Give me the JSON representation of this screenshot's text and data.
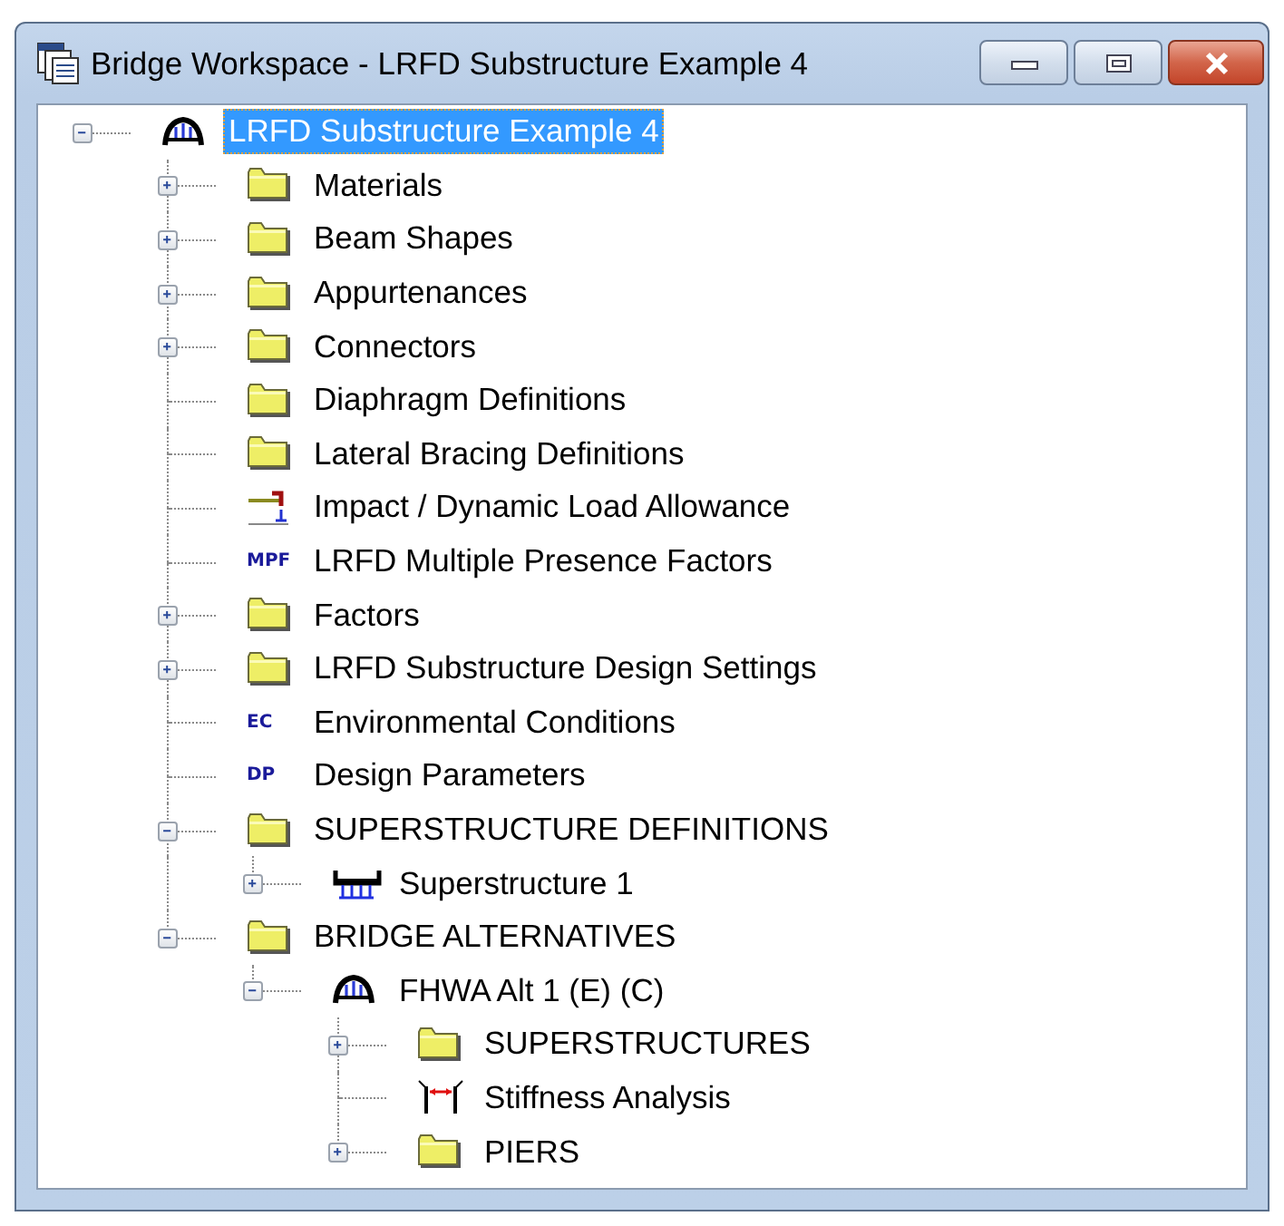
{
  "window": {
    "title": "Bridge Workspace - LRFD Substructure Example 4"
  },
  "tree": [
    {
      "label": "LRFD Substructure Example 4",
      "kind": "bridge",
      "selected": true,
      "expanded": true,
      "children": [
        {
          "label": "Materials",
          "kind": "folder",
          "selected": false,
          "expanded": false
        },
        {
          "label": "Beam Shapes",
          "kind": "folder",
          "selected": false,
          "expanded": false
        },
        {
          "label": "Appurtenances",
          "kind": "folder",
          "selected": false,
          "expanded": false
        },
        {
          "label": "Connectors",
          "kind": "folder",
          "selected": false,
          "expanded": false
        },
        {
          "label": "Diaphragm Definitions",
          "kind": "folder",
          "selected": false
        },
        {
          "label": "Lateral Bracing Definitions",
          "kind": "folder",
          "selected": false
        },
        {
          "label": "Impact / Dynamic Load Allowance",
          "kind": "impact",
          "selected": false
        },
        {
          "label": "LRFD Multiple Presence Factors",
          "kind": "badge",
          "icon_text": "MPF",
          "selected": false
        },
        {
          "label": "Factors",
          "kind": "folder",
          "selected": false,
          "expanded": false
        },
        {
          "label": "LRFD Substructure Design Settings",
          "kind": "folder",
          "selected": false,
          "expanded": false
        },
        {
          "label": "Environmental Conditions",
          "kind": "badge",
          "icon_text": "EC",
          "selected": false
        },
        {
          "label": "Design Parameters",
          "kind": "badge",
          "icon_text": "DP",
          "selected": false
        },
        {
          "label": "SUPERSTRUCTURE DEFINITIONS",
          "kind": "folder",
          "selected": false,
          "expanded": true,
          "children": [
            {
              "label": "Superstructure 1",
              "kind": "superstructure",
              "selected": false,
              "expanded": false
            }
          ]
        },
        {
          "label": "BRIDGE ALTERNATIVES",
          "kind": "folder",
          "selected": false,
          "expanded": true,
          "children": [
            {
              "label": "FHWA Alt 1 (E) (C)",
              "kind": "bridge",
              "selected": false,
              "expanded": true,
              "children": [
                {
                  "label": "SUPERSTRUCTURES",
                  "kind": "folder",
                  "selected": false,
                  "expanded": false
                },
                {
                  "label": "Stiffness Analysis",
                  "kind": "stiffness",
                  "selected": false
                },
                {
                  "label": "PIERS",
                  "kind": "folder",
                  "selected": false,
                  "expanded": false
                }
              ]
            }
          ]
        }
      ]
    }
  ]
}
